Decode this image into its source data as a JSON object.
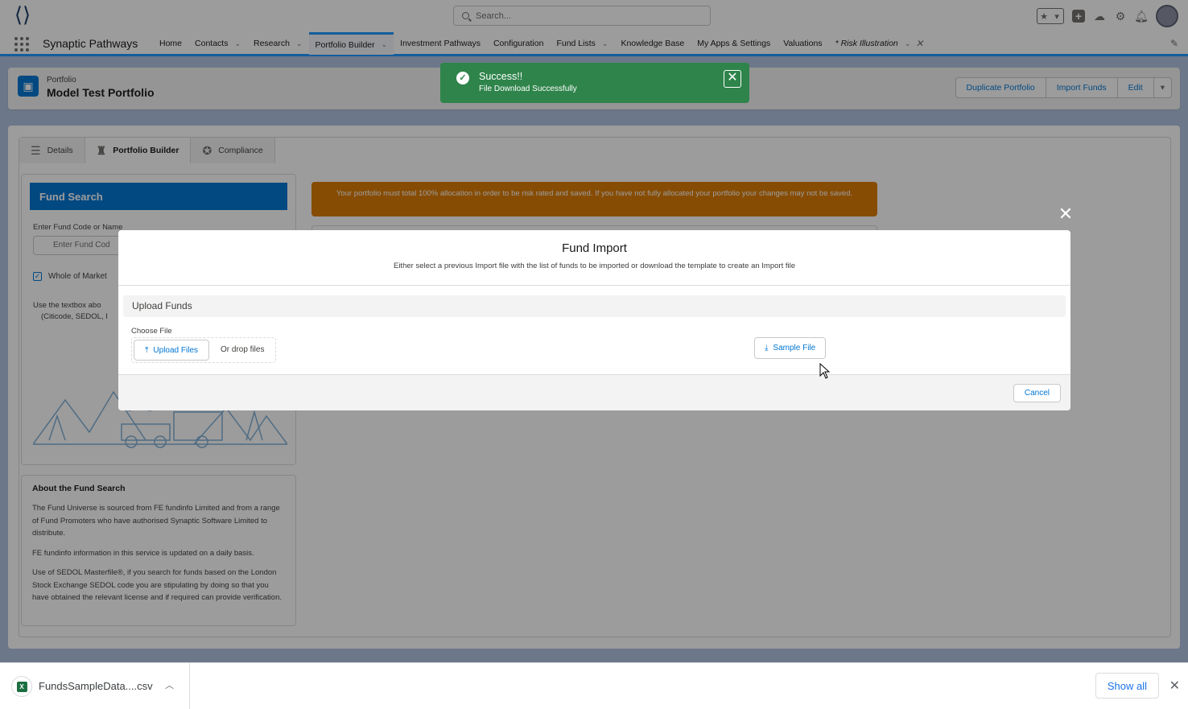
{
  "app": {
    "name": "Synaptic Pathways",
    "search_placeholder": "Search..."
  },
  "nav": {
    "items": [
      {
        "label": "Home",
        "has_menu": false
      },
      {
        "label": "Contacts",
        "has_menu": true
      },
      {
        "label": "Research",
        "has_menu": true
      },
      {
        "label": "Portfolio Builder",
        "has_menu": true
      },
      {
        "label": "Investment Pathways",
        "has_menu": false
      },
      {
        "label": "Configuration",
        "has_menu": false
      },
      {
        "label": "Fund Lists",
        "has_menu": true
      },
      {
        "label": "Knowledge Base",
        "has_menu": false
      },
      {
        "label": "My Apps & Settings",
        "has_menu": false
      },
      {
        "label": "Valuations",
        "has_menu": false
      }
    ],
    "active_index": 3,
    "open_tab": "* Risk Illustration"
  },
  "record": {
    "type": "Portfolio",
    "name": "Model Test Portfolio",
    "actions": [
      "Duplicate Portfolio",
      "Import Funds",
      "Edit"
    ]
  },
  "tabs": [
    "Details",
    "Portfolio Builder",
    "Compliance"
  ],
  "fund_search": {
    "title": "Fund Search",
    "input_label": "Enter Fund Code or Name",
    "input_placeholder": "Enter Fund Cod",
    "checkbox_label": "Whole of Market",
    "help_line1": "Use the textbox abo",
    "help_line2": "(Citicode, SEDOL, I"
  },
  "about": {
    "title": "About the Fund Search",
    "paragraphs": [
      "The Fund Universe is sourced from FE fundinfo Limited and from a range of Fund Promoters who have authorised Synaptic Software Limited to distribute.",
      "FE fundinfo information in this service is updated on a daily basis.",
      "Use of SEDOL Masterfile®, if you search for funds based on the London Stock Exchange SEDOL code you are stipulating by doing so that you have obtained the relevant license and if required can provide verification."
    ]
  },
  "warning": "Your portfolio must total 100% allocation in order to be risk rated and saved. If you have not fully allocated your portfolio your changes may not be saved.",
  "toast": {
    "title": "Success!!",
    "message": "File Download Successfully"
  },
  "modal": {
    "title": "Fund Import",
    "subtitle": "Either select a previous Import file with the list of funds to be imported or download the template to create an Import file",
    "section": "Upload Funds",
    "choose_label": "Choose File",
    "upload_label": "Upload Files",
    "drop_label": "Or drop files",
    "sample_label": "Sample File",
    "cancel_label": "Cancel"
  },
  "download_shelf": {
    "file_name": "FundsSampleData....csv",
    "show_all": "Show all"
  },
  "colors": {
    "brand_blue": "#0176d3",
    "success_green": "#2e844a",
    "warning_orange": "#dd7a01"
  }
}
